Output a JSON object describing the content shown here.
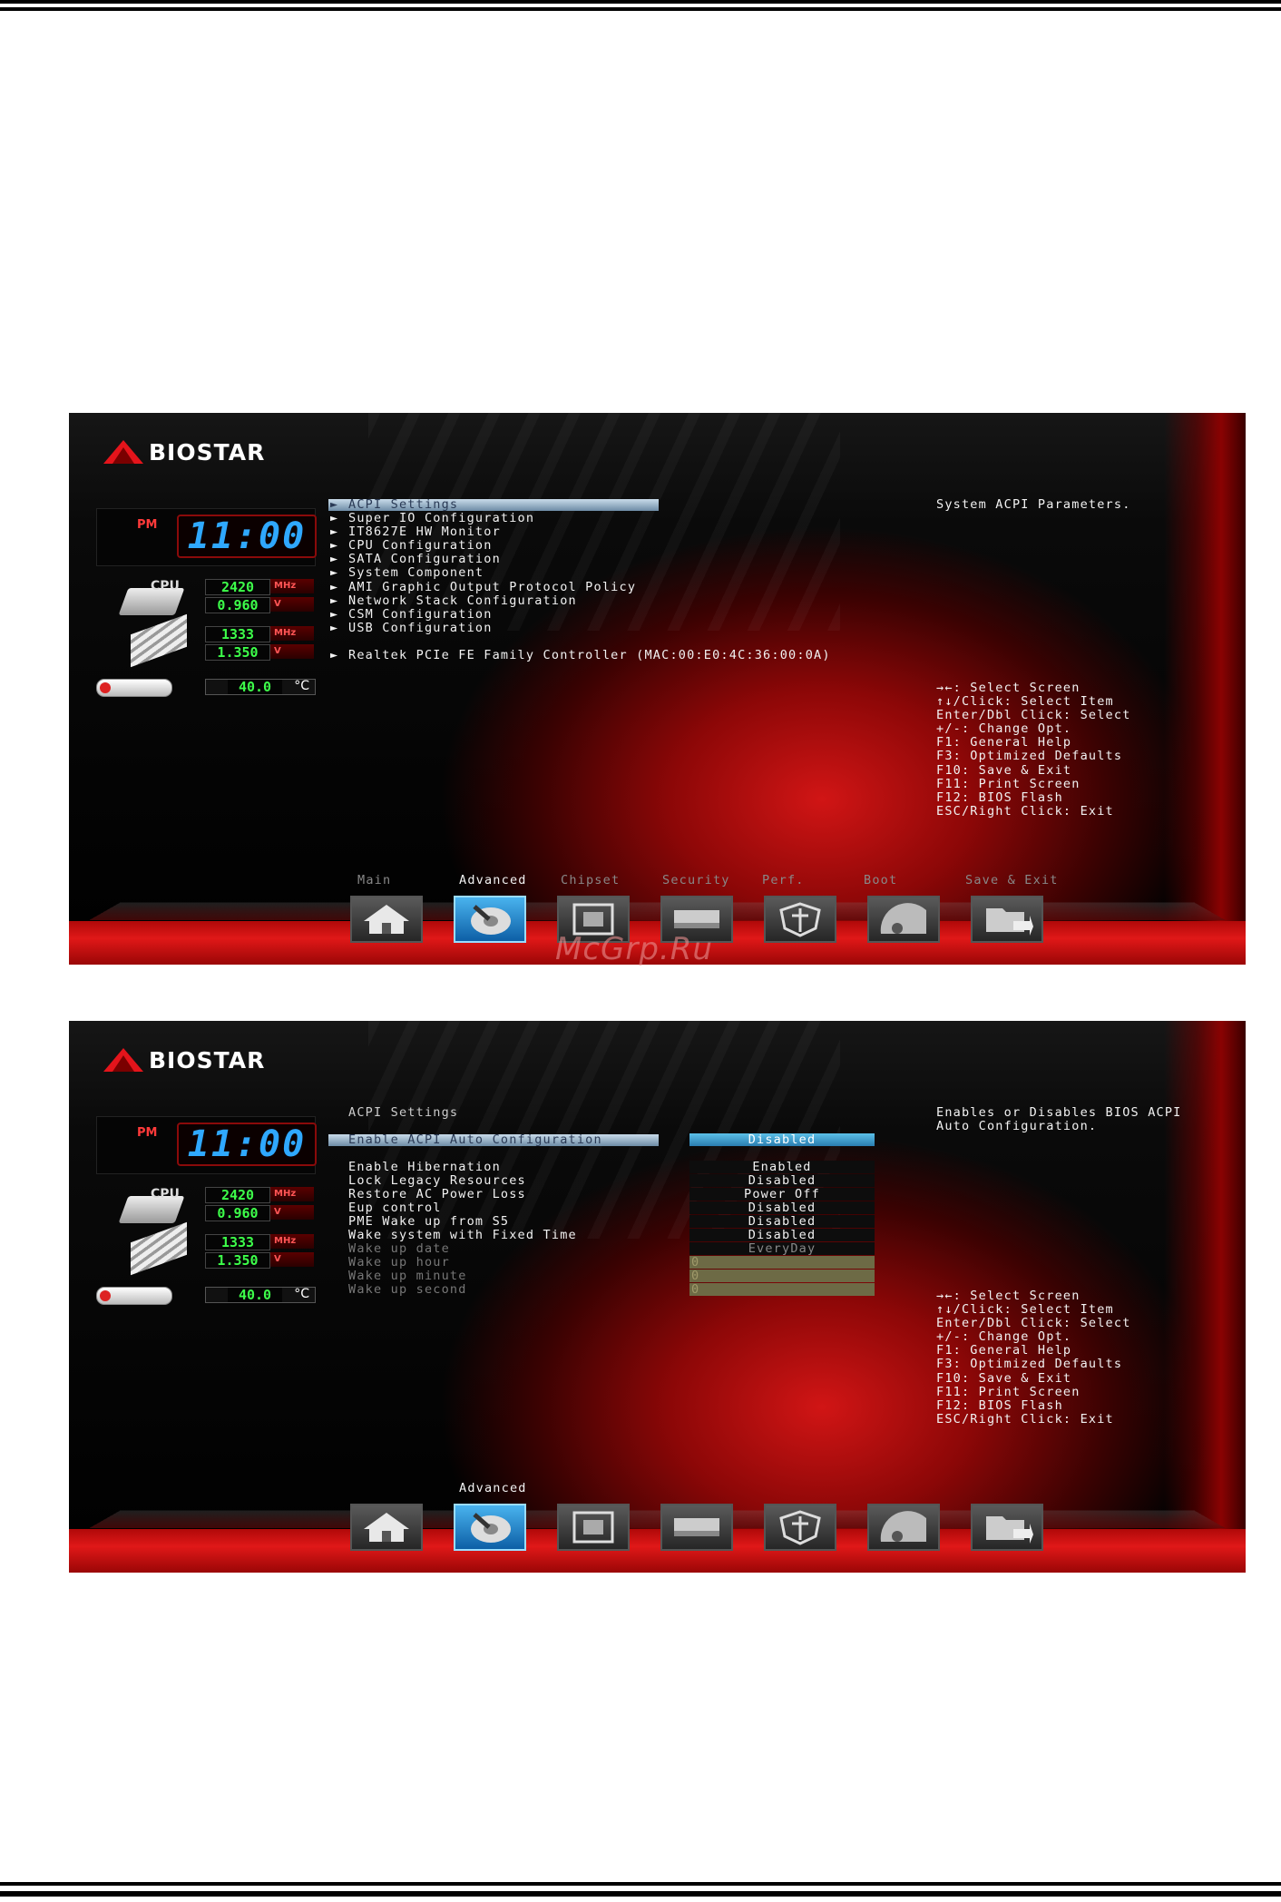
{
  "brand": "BIOSTAR",
  "watermark": "McGrp.Ru",
  "status_panel": {
    "ampm": "PM",
    "time": "11:00",
    "cpu_label": "CPU",
    "cpu_freq": "2420",
    "cpu_freq_unit": "MHz",
    "cpu_volt": "0.960",
    "cpu_volt_unit": "V",
    "mem_freq": "1333",
    "mem_freq_unit": "MHz",
    "mem_volt": "1.350",
    "mem_volt_unit": "V",
    "temperature": "40.0",
    "temperature_unit": "°C"
  },
  "tabs": [
    {
      "label": "Main"
    },
    {
      "label": "Advanced"
    },
    {
      "label": "Chipset"
    },
    {
      "label": "Security"
    },
    {
      "label": "Perf."
    },
    {
      "label": "Boot"
    },
    {
      "label": "Save & Exit"
    }
  ],
  "nav_icons": [
    "home-icon",
    "advanced-icon",
    "chipset-icon",
    "security-icon",
    "performance-icon",
    "boot-icon",
    "save-exit-icon"
  ],
  "key_help": [
    "→←: Select Screen",
    "↑↓/Click: Select Item",
    "Enter/Dbl Click: Select",
    "+/-: Change Opt.",
    "F1: General Help",
    "F3: Optimized Defaults",
    "F10: Save & Exit",
    "F11: Print Screen",
    "F12: BIOS Flash",
    "ESC/Right Click: Exit"
  ],
  "screen1": {
    "menu_items": [
      "ACPI Settings",
      "Super IO Configuration",
      "IT8627E HW Monitor",
      "CPU Configuration",
      "SATA Configuration",
      "System Component",
      "AMI Graphic Output Protocol Policy",
      "Network Stack Configuration",
      "CSM Configuration",
      "USB Configuration"
    ],
    "network_item": "Realtek PCIe FE Family Controller (MAC:00:E0:4C:36:00:0A)",
    "arrow_glyph": "►",
    "help_text": "System ACPI Parameters.",
    "active_tab": "Advanced"
  },
  "screen2": {
    "section_title": "ACPI Settings",
    "help_text": "Enables or Disables BIOS ACPI Auto Configuration.",
    "active_tab": "Advanced",
    "settings": [
      {
        "label": "Enable ACPI Auto Configuration",
        "value": "Disabled"
      },
      {
        "label": "Enable Hibernation",
        "value": "Enabled"
      },
      {
        "label": "Lock Legacy Resources",
        "value": "Disabled"
      },
      {
        "label": "Restore AC Power Loss",
        "value": "Power Off"
      },
      {
        "label": "Eup control",
        "value": "Disabled"
      },
      {
        "label": "PME Wake up from S5",
        "value": "Disabled"
      },
      {
        "label": "Wake system with Fixed Time",
        "value": "Disabled"
      },
      {
        "label": "Wake up date",
        "value": "EveryDay"
      },
      {
        "label": "Wake up hour",
        "value": "0"
      },
      {
        "label": "Wake up minute",
        "value": "0"
      },
      {
        "label": "Wake up second",
        "value": "0"
      }
    ]
  }
}
